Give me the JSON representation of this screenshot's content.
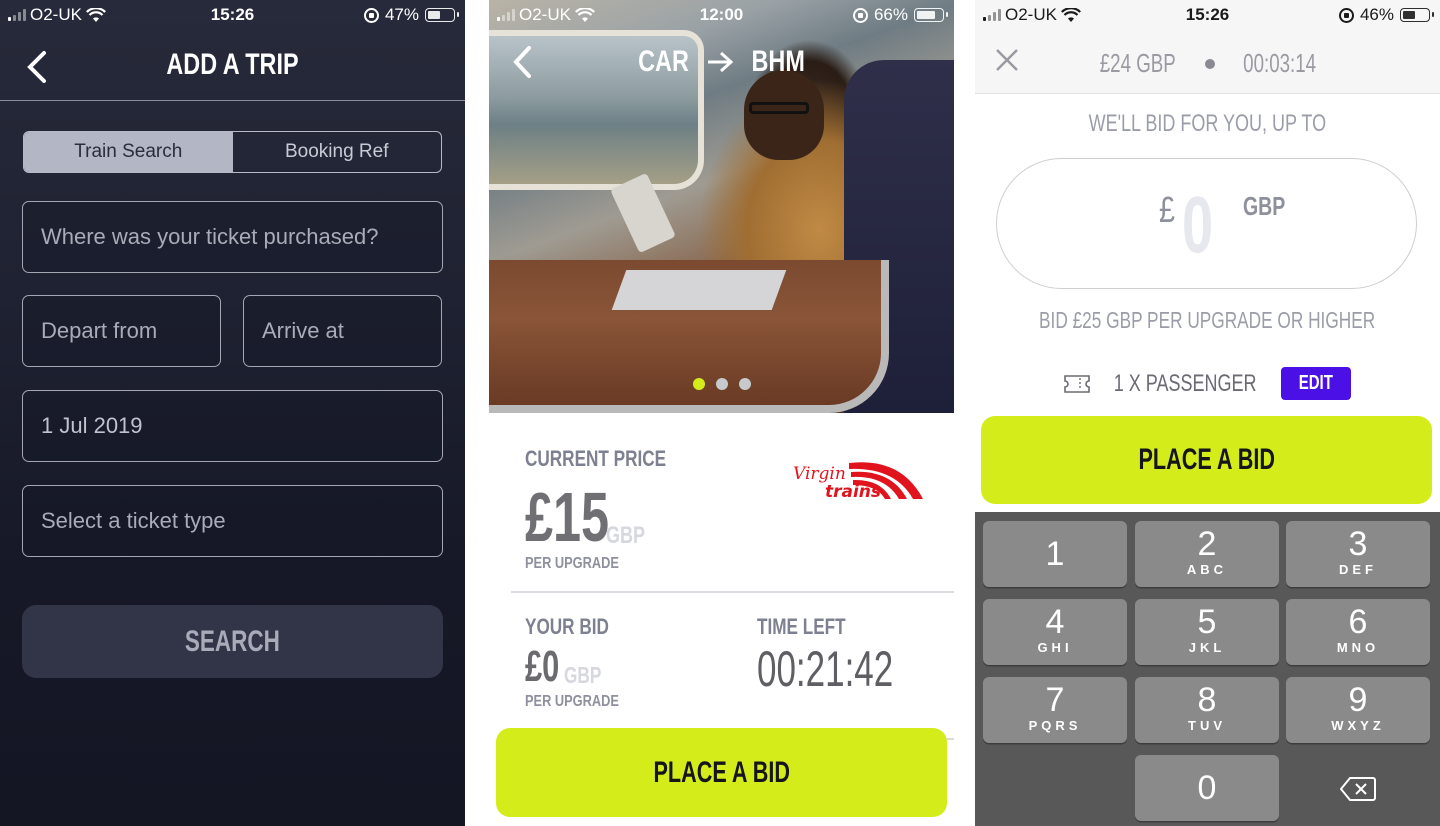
{
  "screen1": {
    "status": {
      "carrier": "O2-UK",
      "time": "15:26",
      "battery": "47%",
      "battery_level": 0.47
    },
    "header": {
      "title": "ADD A TRIP",
      "back_icon": "chevron-left-icon"
    },
    "tabs": [
      {
        "label": "Train Search",
        "active": true
      },
      {
        "label": "Booking Ref",
        "active": false
      }
    ],
    "fields": {
      "purchase_location": {
        "placeholder": "Where was your ticket purchased?"
      },
      "depart_from": {
        "placeholder": "Depart from"
      },
      "arrive_at": {
        "placeholder": "Arrive at"
      },
      "date": {
        "value": "1 Jul 2019"
      },
      "ticket_type": {
        "placeholder": "Select a ticket type"
      }
    },
    "search_button": "SEARCH"
  },
  "screen2": {
    "status": {
      "carrier": "O2-UK",
      "time": "12:00",
      "battery": "66%",
      "battery_level": 0.66
    },
    "route": {
      "from": "CAR",
      "arrow": "→",
      "to": "BHM"
    },
    "carousel": {
      "count": 3,
      "active_index": 0
    },
    "current_price": {
      "label": "CURRENT PRICE",
      "amount": "£15",
      "currency": "GBP",
      "unit": "PER UPGRADE"
    },
    "brand": {
      "logo_text_top": "Virgin",
      "logo_text_bottom": "trains",
      "color": "#e1141e"
    },
    "your_bid": {
      "label": "YOUR BID",
      "amount": "£0",
      "currency": "GBP",
      "unit": "PER UPGRADE"
    },
    "time_left": {
      "label": "TIME LEFT",
      "value": "00:21:42"
    },
    "place_bid_button": "PLACE A BID"
  },
  "screen3": {
    "status": {
      "carrier": "O2-UK",
      "time": "15:26",
      "battery": "46%",
      "battery_level": 0.46
    },
    "summary": {
      "price": "£24 GBP",
      "timer": "00:03:14"
    },
    "prompt": "WE'LL BID FOR YOU, UP TO",
    "bid_input": {
      "symbol": "£",
      "value": "0",
      "currency": "GBP"
    },
    "min_bid_hint": "BID £25 GBP PER UPGRADE OR HIGHER",
    "passengers": {
      "label": "1 X PASSENGER",
      "edit_label": "EDIT"
    },
    "place_bid_button": "PLACE A BID",
    "keypad": [
      {
        "num": "1",
        "letters": ""
      },
      {
        "num": "2",
        "letters": "ABC"
      },
      {
        "num": "3",
        "letters": "DEF"
      },
      {
        "num": "4",
        "letters": "GHI"
      },
      {
        "num": "5",
        "letters": "JKL"
      },
      {
        "num": "6",
        "letters": "MNO"
      },
      {
        "num": "7",
        "letters": "PQRS"
      },
      {
        "num": "8",
        "letters": "TUV"
      },
      {
        "num": "9",
        "letters": "WXYZ"
      },
      {
        "num": "0",
        "letters": ""
      }
    ]
  },
  "colors": {
    "accent_lime": "#d4ed1a",
    "edit_purple": "#4a10e6",
    "dark_bg": "#1f2232"
  }
}
